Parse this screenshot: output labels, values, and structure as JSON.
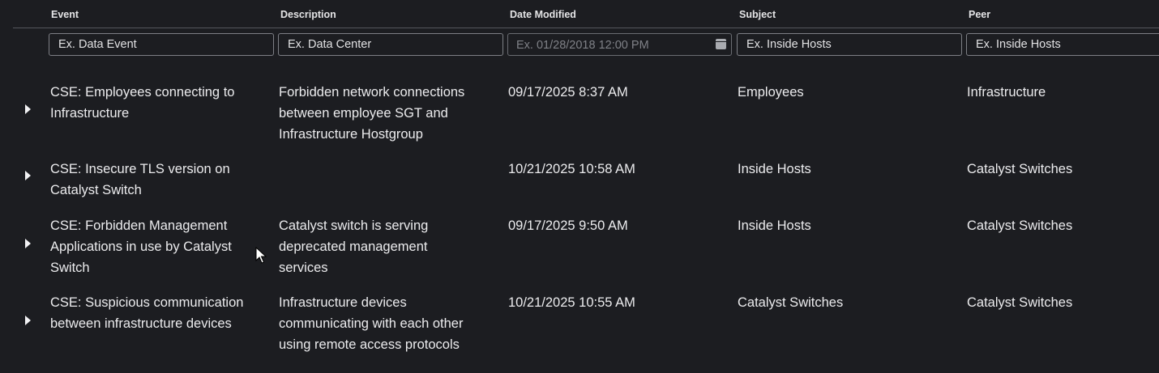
{
  "columns": [
    "Event",
    "Description",
    "Date Modified",
    "Subject",
    "Peer"
  ],
  "filters": {
    "event": "Ex. Data Event",
    "description": "Ex. Data Center",
    "date": "Ex. 01/28/2018 12:00 PM",
    "subject": "Ex. Inside Hosts",
    "peer": "Ex. Inside Hosts"
  },
  "rows": [
    {
      "event": [
        "CSE: Employees connecting to",
        "Infrastructure"
      ],
      "description": [
        "Forbidden network connections",
        "between employee SGT and",
        "Infrastructure Hostgroup"
      ],
      "date": "09/17/2025 8:37 AM",
      "subject": "Employees",
      "peer": "Infrastructure"
    },
    {
      "event": [
        "CSE: Insecure TLS version on",
        "Catalyst Switch"
      ],
      "description": [],
      "date": "10/21/2025 10:58 AM",
      "subject": "Inside Hosts",
      "peer": "Catalyst Switches"
    },
    {
      "event": [
        "CSE: Forbidden Management",
        "Applications in use by Catalyst",
        "Switch"
      ],
      "description": [
        "Catalyst switch is serving",
        "deprecated management",
        "services"
      ],
      "date": "09/17/2025 9:50 AM",
      "subject": "Inside Hosts",
      "peer": "Catalyst Switches"
    },
    {
      "event": [
        "CSE: Suspicious communication",
        "between infrastructure devices"
      ],
      "description": [
        "Infrastructure devices",
        "communicating with each other",
        "using remote access protocols"
      ],
      "date": "10/21/2025 10:55 AM",
      "subject": "Catalyst Switches",
      "peer": "Catalyst Switches"
    }
  ]
}
